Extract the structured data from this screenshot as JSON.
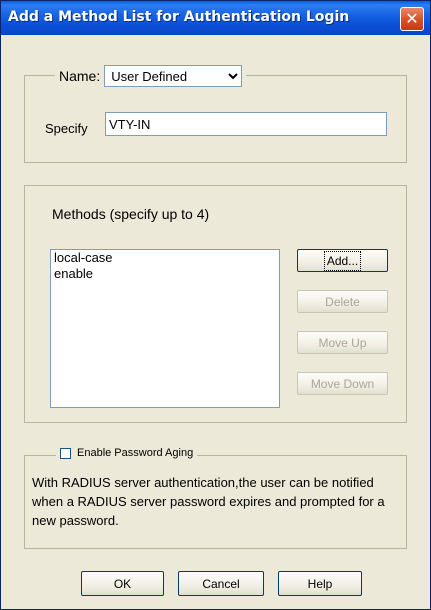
{
  "window": {
    "title": "Add a Method List for Authentication Login",
    "close_glyph": "✕"
  },
  "name_group": {
    "name_label": "Name:",
    "name_selected": "User Defined",
    "specify_label": "Specify",
    "specify_value": "VTY-IN"
  },
  "methods_group": {
    "heading": "Methods (specify up to 4)",
    "items": [
      "local-case",
      "enable"
    ],
    "buttons": {
      "add": "Add...",
      "delete": "Delete",
      "move_up": "Move Up",
      "move_down": "Move Down"
    }
  },
  "aging_group": {
    "checkbox_label": "Enable Password Aging",
    "checked": false,
    "description": "With RADIUS server authentication,the user can be notified when a RADIUS server password expires and prompted for a new password."
  },
  "footer": {
    "ok": "OK",
    "cancel": "Cancel",
    "help": "Help"
  },
  "colors": {
    "titlebar": "#0a52d8",
    "dialog_bg": "#ece9d8",
    "close_button": "#d9532a"
  }
}
